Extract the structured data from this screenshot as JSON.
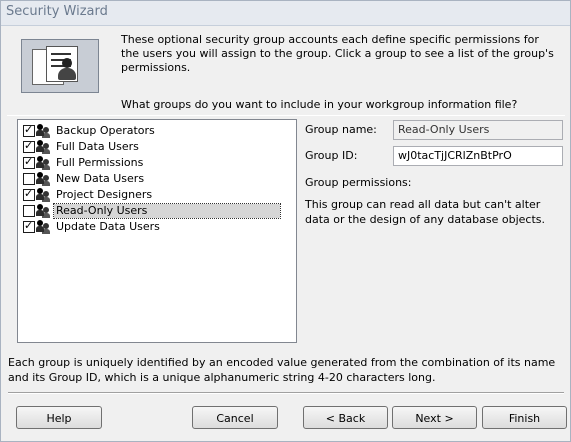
{
  "window": {
    "title": "Security Wizard"
  },
  "header": {
    "description": "These optional security group accounts each define specific permissions for the users you will assign to the group. Click a group to see a list of the group's permissions.",
    "question": "What groups do you want to include in your workgroup information file?"
  },
  "groups": [
    {
      "label": "Backup Operators",
      "checked": true,
      "selected": false
    },
    {
      "label": "Full Data Users",
      "checked": true,
      "selected": false
    },
    {
      "label": "Full Permissions",
      "checked": true,
      "selected": false
    },
    {
      "label": "New Data Users",
      "checked": false,
      "selected": false
    },
    {
      "label": "Project Designers",
      "checked": true,
      "selected": false
    },
    {
      "label": "Read-Only Users",
      "checked": false,
      "selected": true
    },
    {
      "label": "Update Data Users",
      "checked": true,
      "selected": false
    }
  ],
  "details": {
    "group_name_label": "Group name:",
    "group_name_value": "Read-Only Users",
    "group_id_label": "Group ID:",
    "group_id_value": "wJ0tacTjJCRlZnBtPrO",
    "permissions_label": "Group permissions:",
    "permissions_desc": "This group can read all data but can't alter data or the design of any database objects."
  },
  "footer": {
    "note": "Each group is uniquely identified by an encoded value generated from the combination of its name and its Group ID, which is a unique alphanumeric string 4-20 characters long."
  },
  "buttons": {
    "help": "Help",
    "cancel": "Cancel",
    "back": "< Back",
    "next": "Next >",
    "finish": "Finish"
  },
  "check_glyph": "✓"
}
